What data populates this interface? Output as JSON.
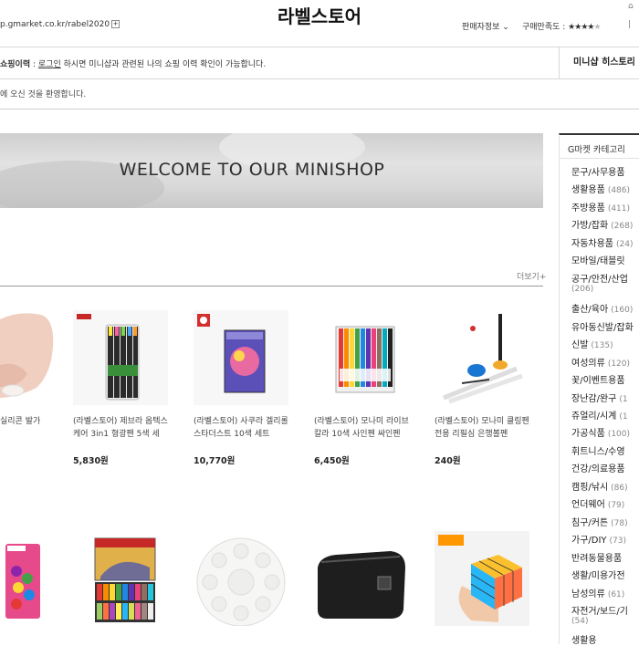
{
  "header": {
    "url_text": "p.gmarket.co.kr/rabel2020",
    "copy_icon": "+",
    "title": "라벨스토어",
    "seller_info_label": "판매자정보",
    "satisfaction_label": "구매만족도 :",
    "rating_stars": 4,
    "rating_max": 5
  },
  "history_bar": {
    "prefix_bold": "쇼핑이력",
    "separator": " : ",
    "login_link": "로그인",
    "message": " 하시면 미니샵과 관련된 나의 쇼핑 이력 확인이 가능합니다.",
    "history_button": "미니샵 히스토리"
  },
  "welcome_message": "에 오신 것을 환영합니다.",
  "banner": {
    "text": "WELCOME TO OUR MINISHOP"
  },
  "more_link": "더보기+",
  "products_row1": [
    {
      "name": "실리콘 발가",
      "price": ""
    },
    {
      "name": "(라벨스토어) 제브라 옵텍스 케어 3in1 형광펜 5색 세",
      "price": "5,830원"
    },
    {
      "name": "(라벨스토어) 사쿠라 겔리롤 스타더스트 10색 세트",
      "price": "10,770원"
    },
    {
      "name": "(라벨스토어) 모나미 라이브칼라 10색 사인펜 싸인펜",
      "price": "6,450원"
    },
    {
      "name": "(라벨스토어) 모나미 클링펜 전용 리필심 은행볼펜",
      "price": "240원"
    }
  ],
  "sidebar": {
    "title": "G마켓 카테고리",
    "categories": [
      {
        "name": "문구/사무용품",
        "count": ""
      },
      {
        "name": "생활용품",
        "count": "(486)"
      },
      {
        "name": "주방용품",
        "count": "(411)"
      },
      {
        "name": "가방/잡화",
        "count": "(268)"
      },
      {
        "name": "자동차용품",
        "count": "(24)"
      },
      {
        "name": "모바일/태블릿",
        "count": ""
      },
      {
        "name": "공구/안전/산업",
        "count": "(206)"
      },
      {
        "name": "출산/육아",
        "count": "(160)"
      },
      {
        "name": "유아동신발/잡화",
        "count": ""
      },
      {
        "name": "신발",
        "count": "(135)"
      },
      {
        "name": "여성의류",
        "count": "(120)"
      },
      {
        "name": "꽃/이벤트용품",
        "count": ""
      },
      {
        "name": "장난감/완구",
        "count": "(1"
      },
      {
        "name": "쥬얼리/시계",
        "count": "(1"
      },
      {
        "name": "가공식품",
        "count": "(100)"
      },
      {
        "name": "휘트니스/수영",
        "count": ""
      },
      {
        "name": "건강/의료용품",
        "count": ""
      },
      {
        "name": "캠핑/낚시",
        "count": "(86)"
      },
      {
        "name": "언더웨어",
        "count": "(79)"
      },
      {
        "name": "침구/커튼",
        "count": "(78)"
      },
      {
        "name": "가구/DIY",
        "count": "(73)"
      },
      {
        "name": "반려동물용품",
        "count": ""
      },
      {
        "name": "생활/미용가전",
        "count": ""
      },
      {
        "name": "남성의류",
        "count": "(61)"
      },
      {
        "name": "자전거/보드/기",
        "count": "(54)"
      },
      {
        "name": "생활용",
        "count": ""
      }
    ]
  },
  "colors": {
    "accent": "#333333",
    "border": "#d8d8d8",
    "banner": "#d6d6d6"
  },
  "icons": [
    "chevron-down-icon",
    "star-icon",
    "copy-icon"
  ]
}
